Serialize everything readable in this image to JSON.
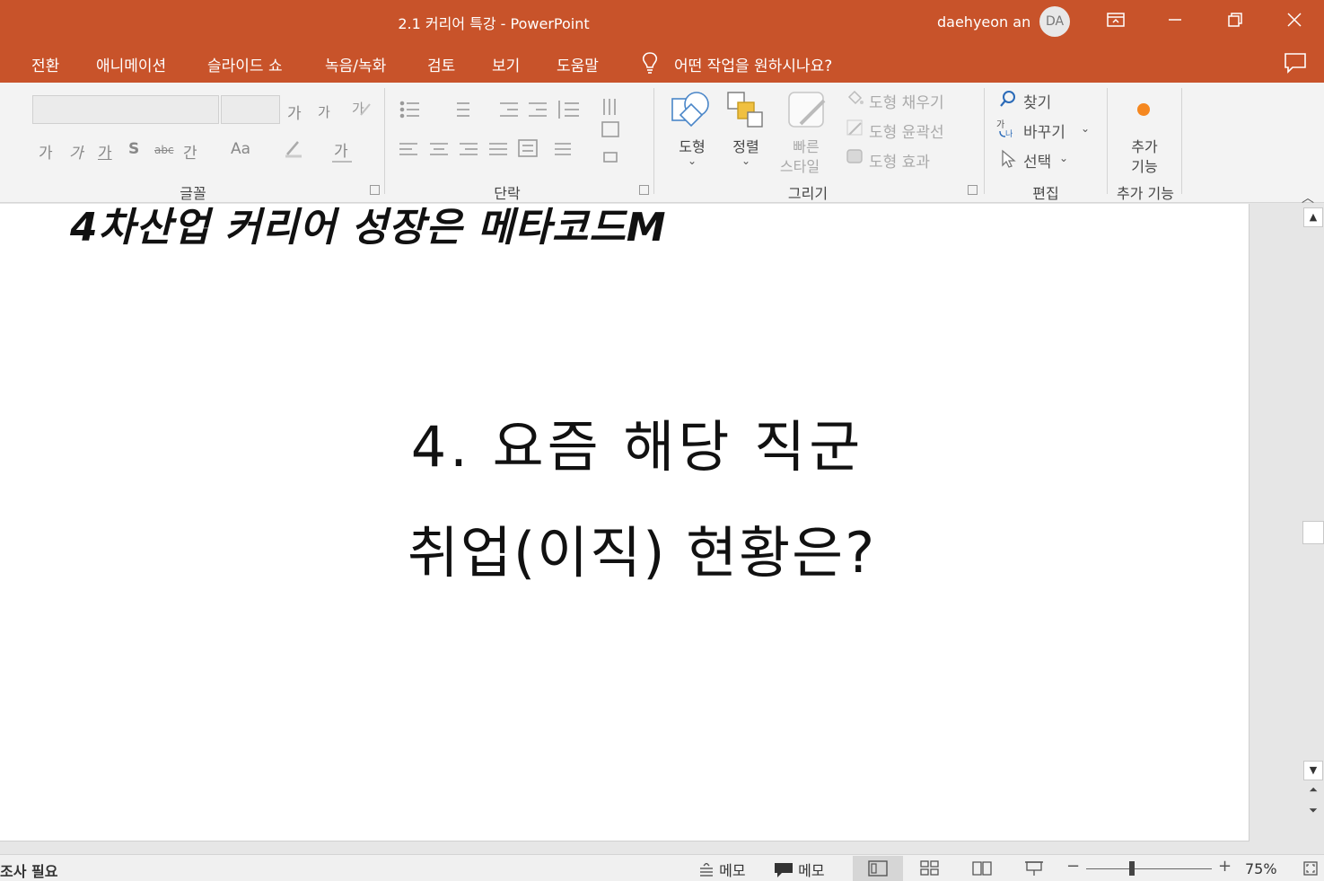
{
  "window": {
    "title": "2.1 커리어 특강  -  PowerPoint",
    "user_name": "daehyeon an",
    "user_initials": "DA"
  },
  "icons": [
    "ribbon-display-options-icon",
    "minimize-icon",
    "restore-icon",
    "close-icon",
    "lightbulb-icon",
    "comment-icon"
  ],
  "menu": {
    "tabs": [
      "전환",
      "애니메이션",
      "슬라이드 쇼",
      "녹음/녹화",
      "검토",
      "보기",
      "도움말"
    ],
    "tell_me": "어떤 작업을 원하시나요?"
  },
  "ribbon": {
    "font_group": {
      "label": "글꼴",
      "font_name": "",
      "font_size": "",
      "grow_font": "가",
      "shrink_font": "가",
      "bold": "가",
      "italic": "가",
      "underline": "가",
      "shadow": "S",
      "strikethrough": "abc",
      "spacing": "간",
      "change_case": "Aa",
      "font_color": "가"
    },
    "paragraph_group": {
      "label": "단락"
    },
    "drawing_group": {
      "label": "그리기",
      "shapes": "도형",
      "arrange": "정렬",
      "quick_styles_1": "빠른",
      "quick_styles_2": "스타일",
      "shape_fill": "도형 채우기",
      "shape_outline": "도형 윤곽선",
      "shape_effects": "도형 효과"
    },
    "editing_group": {
      "label": "편집",
      "find": "찾기",
      "replace": "바꾸기",
      "select": "선택"
    },
    "addins_group": {
      "label": "추가 기능",
      "button_1": "추가",
      "button_2": "기능",
      "accent": "#f5871f"
    }
  },
  "slide": {
    "banner": "4차산업 커리어 성장은 메타코드M",
    "line1": "4. 요즘 해당 직군",
    "line2": "취업(이직) 현황은?"
  },
  "status": {
    "left_text": "조사 필요",
    "notes": "메모",
    "comments": "메모",
    "zoom": "75%"
  },
  "colors": {
    "brand": "#c8532a",
    "ribbon_bg": "#f3f3f3",
    "slide_bg": "#ffffff"
  }
}
